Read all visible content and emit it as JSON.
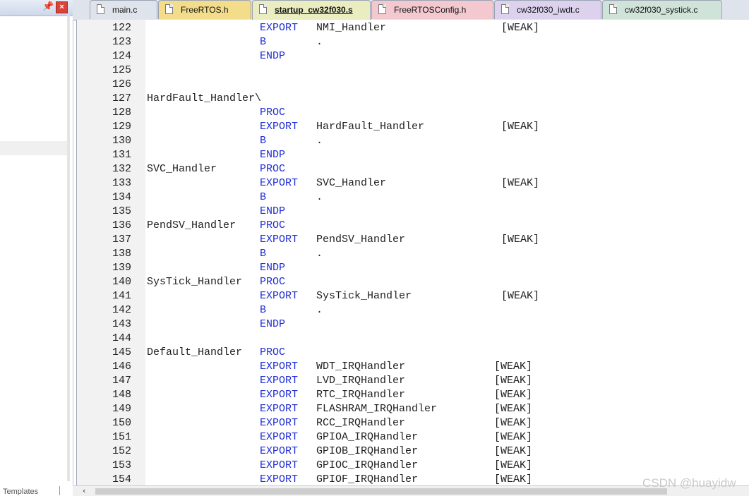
{
  "left_panel": {
    "pin_icon": "pin-icon",
    "close_icon": "close-icon",
    "templates_label": "Templates"
  },
  "tabs": [
    {
      "label": "main.c",
      "color": "#dfe4ec",
      "active": false
    },
    {
      "label": "FreeRTOS.h",
      "color": "#f3dc8a",
      "active": false
    },
    {
      "label": "startup_cw32f030.s",
      "color": "#e9edc0",
      "active": true
    },
    {
      "label": "FreeRTOSConfig.h",
      "color": "#f3c9cf",
      "active": false
    },
    {
      "label": "cw32f030_iwdt.c",
      "color": "#dcd2ee",
      "active": false
    },
    {
      "label": "cw32f030_systick.c",
      "color": "#cfe3d8",
      "active": false
    }
  ],
  "editor": {
    "lines": [
      {
        "n": "122",
        "label": "",
        "kw": "EXPORT",
        "arg": "NMI_Handler",
        "attr": "[WEAK]"
      },
      {
        "n": "123",
        "label": "",
        "kw": "B",
        "arg": ".",
        "attr": ""
      },
      {
        "n": "124",
        "label": "",
        "kw": "ENDP",
        "arg": "",
        "attr": ""
      },
      {
        "n": "125",
        "label": "",
        "kw": "",
        "arg": "",
        "attr": ""
      },
      {
        "n": "126",
        "label": "",
        "kw": "",
        "arg": "",
        "attr": ""
      },
      {
        "n": "127",
        "label": "HardFault_Handler\\",
        "kw": "",
        "arg": "",
        "attr": ""
      },
      {
        "n": "128",
        "label": "",
        "kw": "PROC",
        "arg": "",
        "attr": ""
      },
      {
        "n": "129",
        "label": "",
        "kw": "EXPORT",
        "arg": "HardFault_Handler",
        "attr": "[WEAK]"
      },
      {
        "n": "130",
        "label": "",
        "kw": "B",
        "arg": ".",
        "attr": ""
      },
      {
        "n": "131",
        "label": "",
        "kw": "ENDP",
        "arg": "",
        "attr": ""
      },
      {
        "n": "132",
        "label": "SVC_Handler",
        "kw": "PROC",
        "arg": "",
        "attr": ""
      },
      {
        "n": "133",
        "label": "",
        "kw": "EXPORT",
        "arg": "SVC_Handler",
        "attr": "[WEAK]"
      },
      {
        "n": "134",
        "label": "",
        "kw": "B",
        "arg": ".",
        "attr": ""
      },
      {
        "n": "135",
        "label": "",
        "kw": "ENDP",
        "arg": "",
        "attr": ""
      },
      {
        "n": "136",
        "label": "PendSV_Handler",
        "kw": "PROC",
        "arg": "",
        "attr": ""
      },
      {
        "n": "137",
        "label": "",
        "kw": "EXPORT",
        "arg": "PendSV_Handler",
        "attr": "[WEAK]"
      },
      {
        "n": "138",
        "label": "",
        "kw": "B",
        "arg": ".",
        "attr": ""
      },
      {
        "n": "139",
        "label": "",
        "kw": "ENDP",
        "arg": "",
        "attr": ""
      },
      {
        "n": "140",
        "label": "SysTick_Handler",
        "kw": "PROC",
        "arg": "",
        "attr": ""
      },
      {
        "n": "141",
        "label": "",
        "kw": "EXPORT",
        "arg": "SysTick_Handler",
        "attr": "[WEAK]"
      },
      {
        "n": "142",
        "label": "",
        "kw": "B",
        "arg": ".",
        "attr": ""
      },
      {
        "n": "143",
        "label": "",
        "kw": "ENDP",
        "arg": "",
        "attr": ""
      },
      {
        "n": "144",
        "label": "",
        "kw": "",
        "arg": "",
        "attr": ""
      },
      {
        "n": "145",
        "label": "Default_Handler",
        "kw": "PROC",
        "arg": "",
        "attr": ""
      },
      {
        "n": "146",
        "label": "",
        "kw": "EXPORT",
        "arg": "WDT_IRQHandler",
        "attr": "[WEAK]"
      },
      {
        "n": "147",
        "label": "",
        "kw": "EXPORT",
        "arg": "LVD_IRQHandler",
        "attr": "[WEAK]"
      },
      {
        "n": "148",
        "label": "",
        "kw": "EXPORT",
        "arg": "RTC_IRQHandler",
        "attr": "[WEAK]"
      },
      {
        "n": "149",
        "label": "",
        "kw": "EXPORT",
        "arg": "FLASHRAM_IRQHandler",
        "attr": "[WEAK]"
      },
      {
        "n": "150",
        "label": "",
        "kw": "EXPORT",
        "arg": "RCC_IRQHandler",
        "attr": "[WEAK]"
      },
      {
        "n": "151",
        "label": "",
        "kw": "EXPORT",
        "arg": "GPIOA_IRQHandler",
        "attr": "[WEAK]"
      },
      {
        "n": "152",
        "label": "",
        "kw": "EXPORT",
        "arg": "GPIOB_IRQHandler",
        "attr": "[WEAK]"
      },
      {
        "n": "153",
        "label": "",
        "kw": "EXPORT",
        "arg": "GPIOC_IRQHandler",
        "attr": "[WEAK]"
      },
      {
        "n": "154",
        "label": "",
        "kw": "EXPORT",
        "arg": "GPIOF_IRQHandler",
        "attr": "[WEAK]"
      }
    ]
  },
  "scrollbar": {
    "left_arrow_icon": "arrow-left-icon"
  },
  "watermark": "CSDN @huayidw",
  "colors": {
    "keyword": "#1f2dd6",
    "text": "#1f1f1f",
    "gutter": "#f2f2f2"
  }
}
